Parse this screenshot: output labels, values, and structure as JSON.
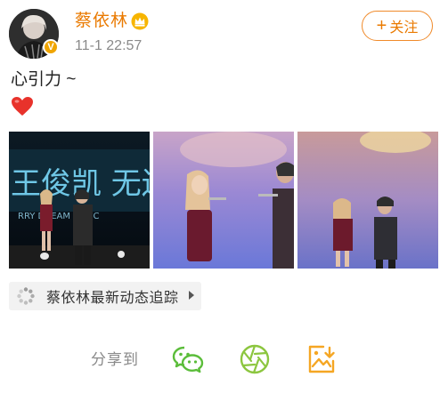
{
  "header": {
    "username": "蔡依林",
    "timestamp": "11-1 22:57",
    "follow_label": "关注",
    "verified_mark": "V"
  },
  "post": {
    "text": "心引力 ~",
    "emoji": "heart-emoji"
  },
  "photos": [
    {
      "alt": "concert-photo-1",
      "sign_text": "王俊凯 无边",
      "sub_text": "RRY  DREAM CONC"
    },
    {
      "alt": "concert-photo-2"
    },
    {
      "alt": "concert-photo-3"
    }
  ],
  "topic": {
    "label": "蔡依林最新动态追踪"
  },
  "share": {
    "label": "分享到",
    "icons": [
      "wechat-icon",
      "moments-icon",
      "save-image-icon"
    ]
  },
  "colors": {
    "brand_orange": "#ea7a00",
    "wechat_green": "#5bbd3a",
    "moments_green": "#8cc63f",
    "save_orange": "#f5a623"
  }
}
